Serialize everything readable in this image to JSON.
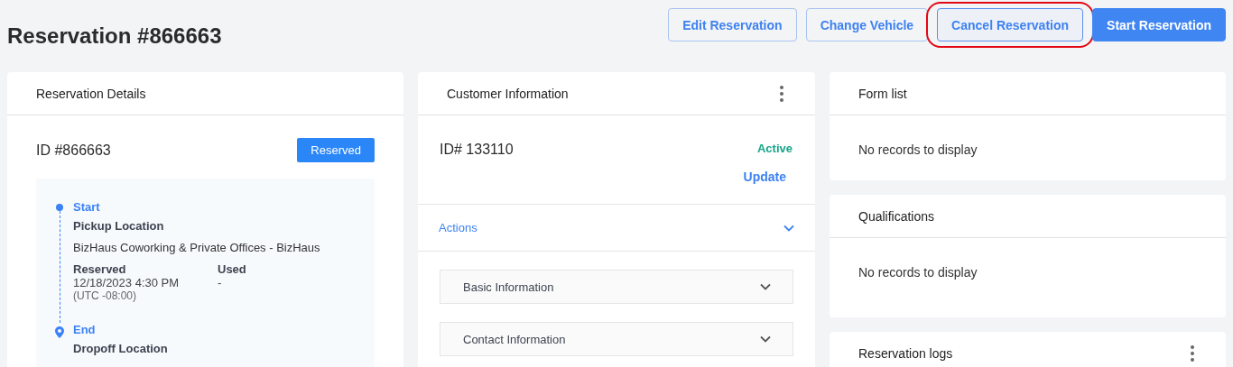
{
  "page": {
    "title": "Reservation #866663"
  },
  "actions": [
    {
      "label": "Edit Reservation",
      "kind": "outline",
      "highlighted": false
    },
    {
      "label": "Change Vehicle",
      "kind": "outline",
      "highlighted": false
    },
    {
      "label": "Cancel Reservation",
      "kind": "outline",
      "highlighted": true
    },
    {
      "label": "Start Reservation",
      "kind": "primary",
      "highlighted": false
    }
  ],
  "reservation_details": {
    "title": "Reservation Details",
    "id": "ID #866663",
    "status": "Reserved",
    "timeline": [
      {
        "kind": "start",
        "label": "Start",
        "location_label": "Pickup Location",
        "location": "BizHaus Coworking & Private Offices - BizHaus",
        "reserved_label": "Reserved",
        "reserved": "12/18/2023 4:30 PM",
        "timezone": "(UTC -08:00)",
        "used_label": "Used",
        "used": "-"
      },
      {
        "kind": "end",
        "label": "End",
        "location_label": "Dropoff Location"
      }
    ]
  },
  "customer_information": {
    "title": "Customer Information",
    "menu": true,
    "id": "ID# 133110",
    "status": "Active",
    "update": "Update",
    "actions_label": "Actions",
    "sections": [
      {
        "label": "Basic Information"
      },
      {
        "label": "Contact Information"
      }
    ]
  },
  "side_cards": [
    {
      "title": "Form list",
      "menu": false,
      "empty": "No records to display"
    },
    {
      "title": "Qualifications",
      "menu": false,
      "empty": "No records to display"
    },
    {
      "title": "Reservation logs",
      "menu": true
    }
  ]
}
